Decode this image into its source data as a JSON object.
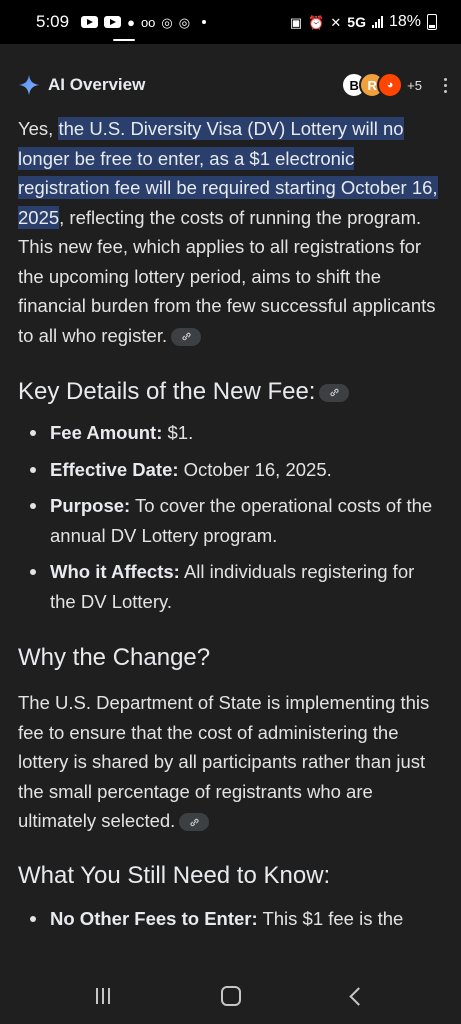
{
  "status_bar": {
    "time": "5:09",
    "network": "5G",
    "battery": "18%"
  },
  "header": {
    "title": "AI Overview",
    "sources_count": "+5",
    "source_avatar_letters": [
      "B",
      "R"
    ]
  },
  "intro": {
    "prefix": "Yes, ",
    "highlight": "the U.S. Diversity Visa (DV) Lottery will no longer be free to enter, as a $1 electronic registration fee will be required starting October 16, 2025",
    "suffix": ", reflecting the costs of running the program. This new fee, which applies to all registrations for the upcoming lottery period, aims to shift the financial burden from the few successful applicants to all who register."
  },
  "key_details": {
    "heading": "Key Details of the New Fee:",
    "items": [
      {
        "label": "Fee Amount:",
        "text": " $1."
      },
      {
        "label": "Effective Date:",
        "text": " October 16, 2025."
      },
      {
        "label": "Purpose:",
        "text": " To cover the operational costs of the annual DV Lottery program."
      },
      {
        "label": "Who it Affects:",
        "text": " All individuals registering for the DV Lottery."
      }
    ]
  },
  "why": {
    "heading": "Why the Change?",
    "text": "The U.S. Department of State is implementing this fee to ensure that the cost of administering the lottery is shared by all participants rather than just the small percentage of registrants who are ultimately selected."
  },
  "still_know": {
    "heading": "What You Still Need to Know:",
    "items": [
      {
        "label": "No Other Fees to Enter:",
        "text": " This $1 fee is the"
      }
    ]
  },
  "colors": {
    "background": "#1f1f1f",
    "highlight": "#2a3f6b",
    "text": "#e3e3e3"
  }
}
